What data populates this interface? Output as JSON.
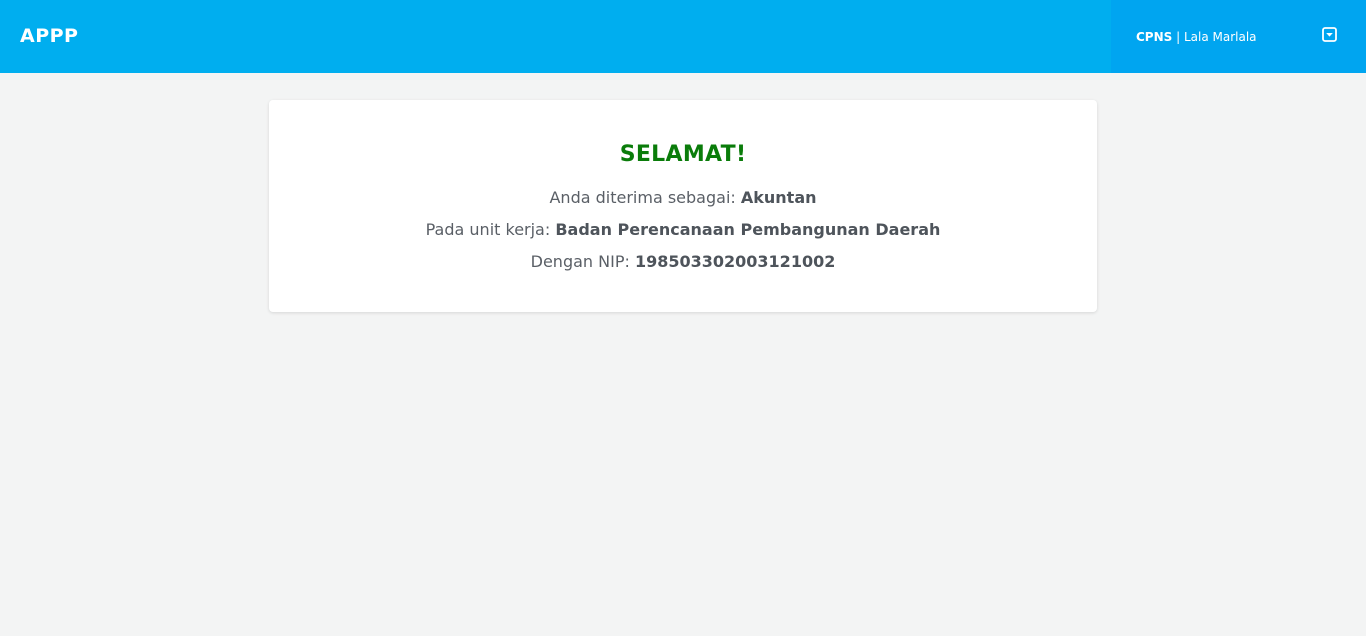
{
  "header": {
    "brand": "APPP",
    "user_role": "CPNS",
    "separator": " | ",
    "user_name": "Lala Marlala",
    "menu_icon": "chevron-down-square-icon"
  },
  "result": {
    "heading": "SELAMAT!",
    "position_label": "Anda diterima sebagai: ",
    "position_value": "Akuntan",
    "unit_label": "Pada unit kerja: ",
    "unit_value": "Badan Perencanaan Pembangunan Daerah",
    "nip_label": "Dengan NIP: ",
    "nip_value": "198503302003121002"
  },
  "colors": {
    "header_bg": "#00aeef",
    "user_area_bg": "#00a5f0",
    "page_bg": "#f3f4f4",
    "heading": "#0a7c0a"
  }
}
